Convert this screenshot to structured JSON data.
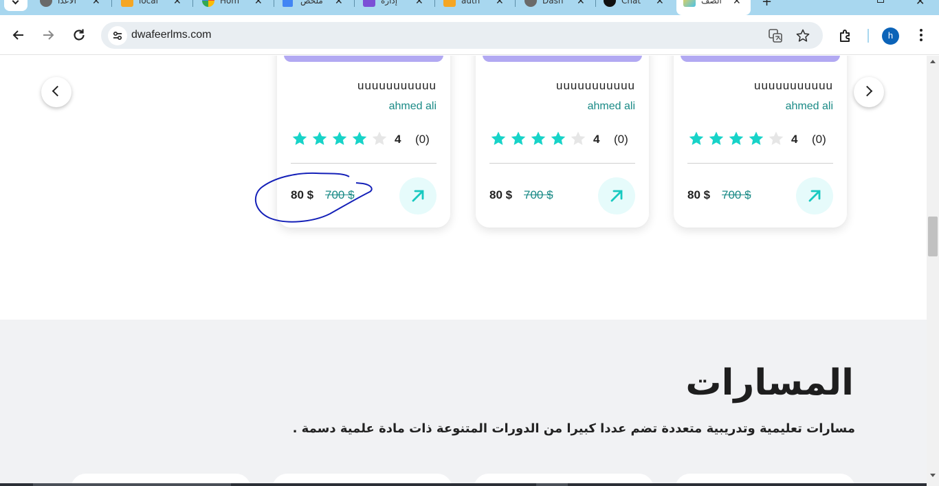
{
  "browser": {
    "tabs": [
      {
        "title": "الأعدا",
        "icon": "globe-icon"
      },
      {
        "title": "local",
        "icon": "phpmyadmin-icon"
      },
      {
        "title": "Hom",
        "icon": "google-photos-icon"
      },
      {
        "title": "ملخص",
        "icon": "docs-icon"
      },
      {
        "title": "إدارة",
        "icon": "store-icon"
      },
      {
        "title": "auth",
        "icon": "phpmyadmin-icon"
      },
      {
        "title": "Dash",
        "icon": "globe-icon"
      },
      {
        "title": "Chat",
        "icon": "openai-icon"
      },
      {
        "title": "الصف",
        "icon": "site-favicon-icon",
        "active": true
      }
    ],
    "new_tab": "+",
    "close_glyph": "✕",
    "url": "dwafeerlms.com",
    "profile_initial": "h",
    "colors": {
      "tabstrip": "#a8d7ef",
      "omnibox": "#e9eef2",
      "avatar": "#0b63b8"
    }
  },
  "carousel": {
    "cards": [
      {
        "title": "uuuuuuuuuuu",
        "instructor": "ahmed ali",
        "rating": "4",
        "rating_value": 4,
        "reviews": "(0)",
        "price": "80 $",
        "old_price": "700 $"
      },
      {
        "title": "uuuuuuuuuuu",
        "instructor": "ahmed ali",
        "rating": "4",
        "rating_value": 4,
        "reviews": "(0)",
        "price": "80 $",
        "old_price": "700 $"
      },
      {
        "title": "uuuuuuuuuuu",
        "instructor": "ahmed ali",
        "rating": "4",
        "rating_value": 4,
        "reviews": "(0)",
        "price": "80 $",
        "old_price": "700 $"
      }
    ],
    "colors": {
      "thumb": "#b2a9f2",
      "star": "#17d3c8",
      "star_empty": "#e6e6e6",
      "accent": "#1a8a86",
      "go_button_bg": "#e6fbfb"
    }
  },
  "paths": {
    "title": "المسارات",
    "description": "مسارات تعليمية وتدريبية متعددة تضم عددا كبيرا من الدورات المتنوعة ذات مادة علمية دسمة ."
  }
}
